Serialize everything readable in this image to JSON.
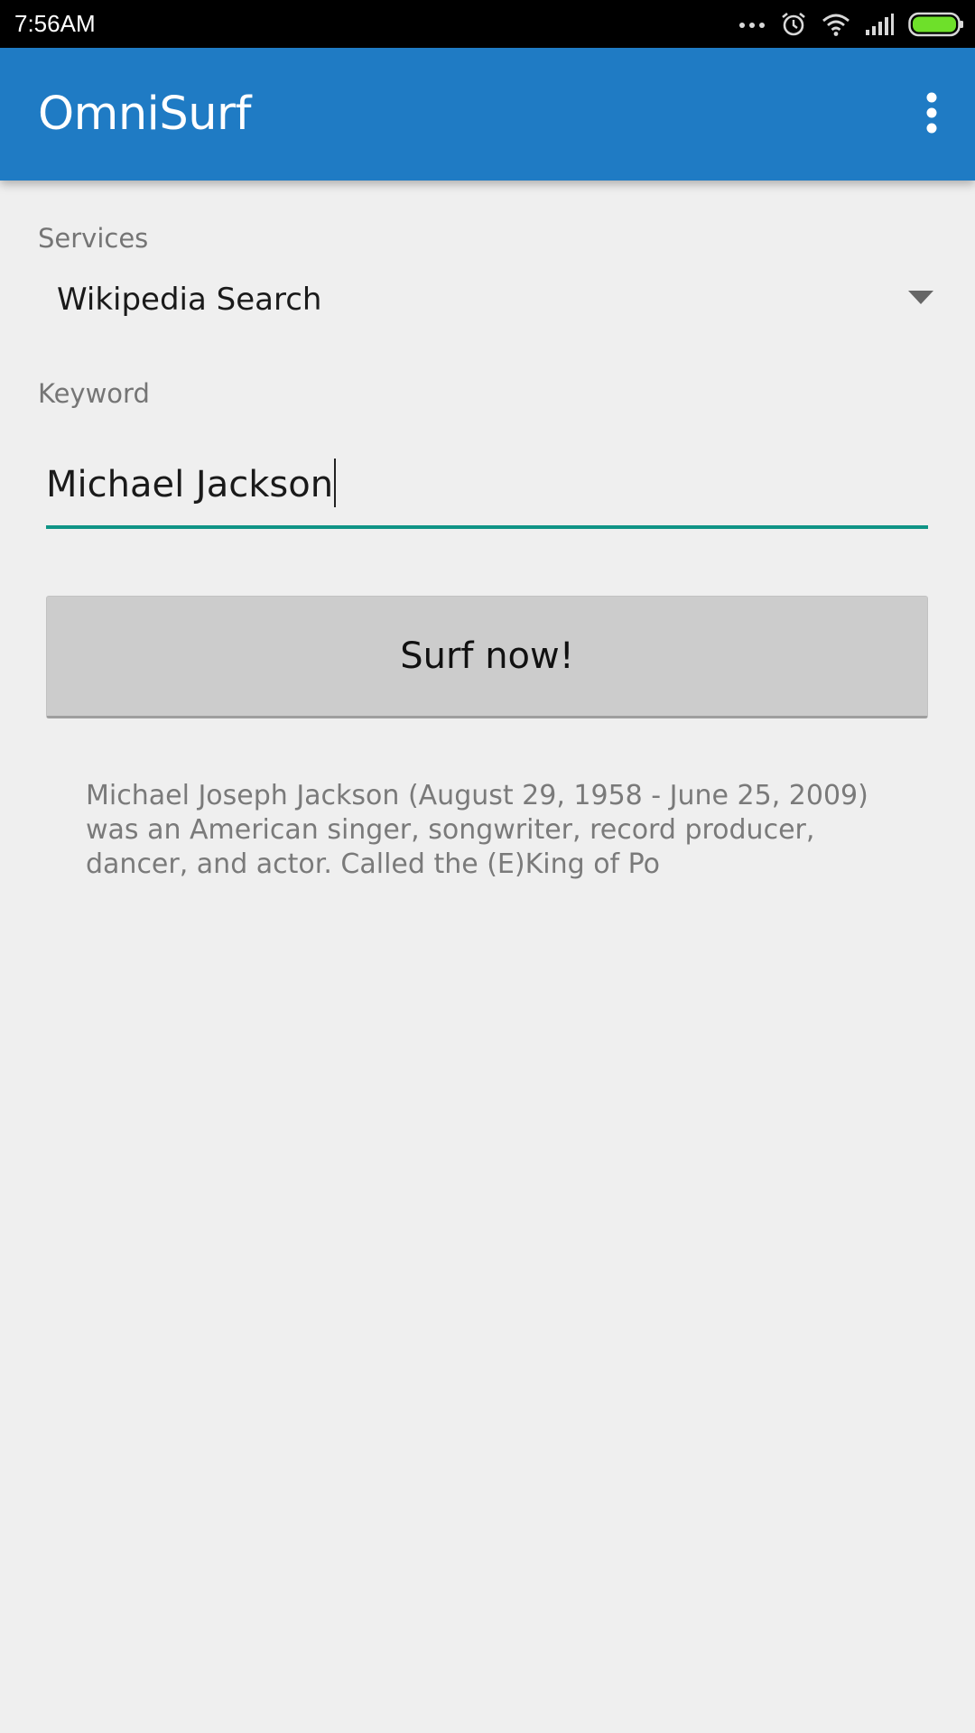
{
  "status_bar": {
    "time": "7:56AM",
    "icons": [
      "more-dots-icon",
      "alarm-icon",
      "wifi-icon",
      "signal-icon",
      "battery-icon"
    ],
    "battery_color": "#6ee02a"
  },
  "app_bar": {
    "title": "OmniSurf",
    "overflow_icon": "overflow-menu-icon",
    "color": "#1f7bc4"
  },
  "form": {
    "services_label": "Services",
    "services_selected": "Wikipedia Search",
    "keyword_label": "Keyword",
    "keyword_value": "Michael Jackson",
    "accent_color": "#0f9486",
    "submit_label": "Surf now!"
  },
  "result": {
    "text": "Michael Joseph Jackson (August 29, 1958 - June 25, 2009) was an American singer, songwriter, record producer, dancer, and actor. Called the (E)King of Po"
  }
}
